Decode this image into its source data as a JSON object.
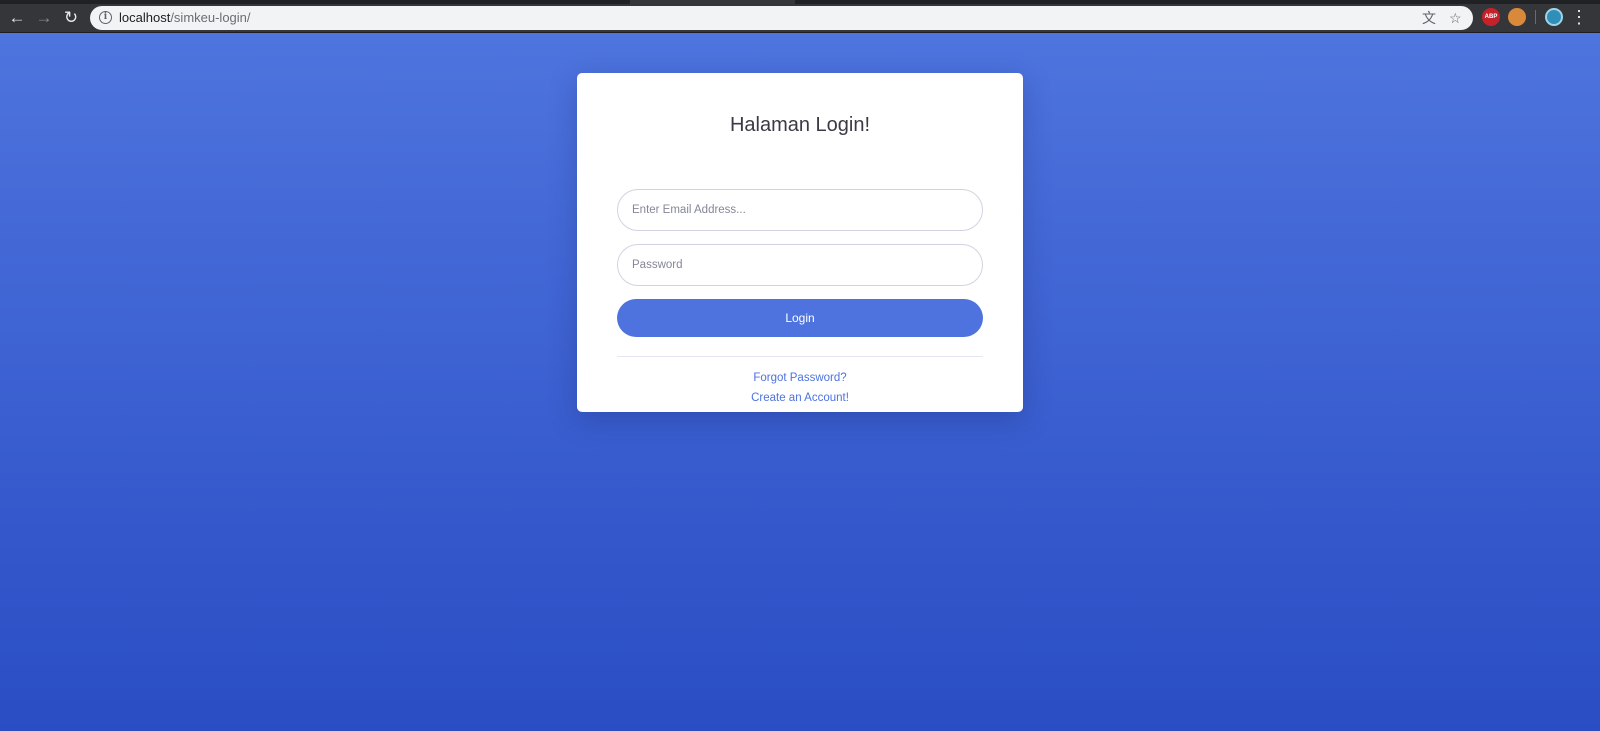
{
  "browser": {
    "url_host": "localhost",
    "url_path": "/simkeu-login/",
    "back_icon": "arrow-left-icon",
    "forward_icon": "arrow-right-icon",
    "reload_icon": "reload-icon",
    "info_glyph": "i",
    "extensions": {
      "abp_label": "ABP"
    }
  },
  "login": {
    "title": "Halaman Login!",
    "email_placeholder": "Enter Email Address...",
    "password_placeholder": "Password",
    "login_label": "Login",
    "forgot_label": "Forgot Password?",
    "create_label": "Create an Account!"
  },
  "colors": {
    "primary": "#4e73df",
    "background_top": "#4e74de",
    "background_bottom": "#2a4dc4"
  }
}
